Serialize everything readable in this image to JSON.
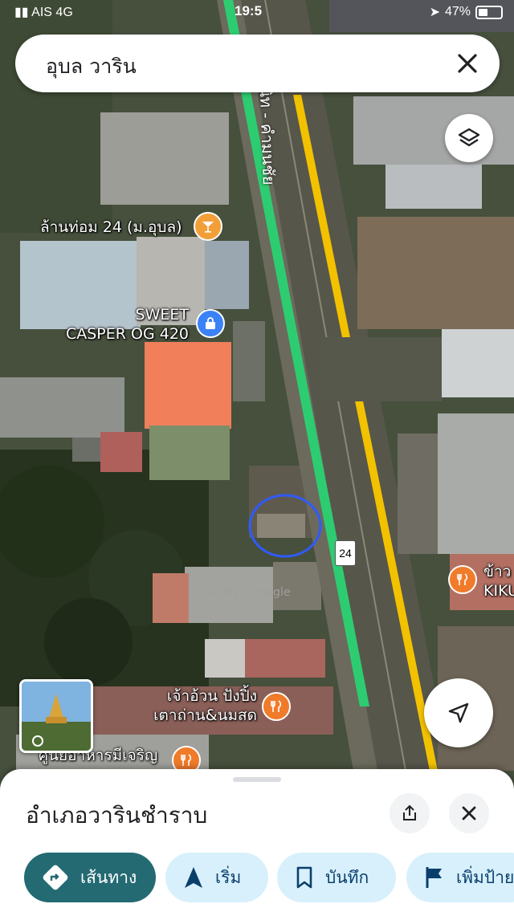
{
  "status_bar": {
    "carrier": "AIS",
    "network": "4G",
    "time": "19:5",
    "battery": "47%"
  },
  "search": {
    "query": "อุบล วาริน"
  },
  "road": {
    "name": "แจ้งสนิท - คำมนชัย",
    "shield": "24"
  },
  "pois": [
    {
      "label_lines": [
        "ล้านท่อม 24 (ม.อุบล)"
      ],
      "type": "bar",
      "color": "#f29f39"
    },
    {
      "label_lines": [
        "SWEET",
        "CASPER OG 420"
      ],
      "type": "shopping",
      "color": "#3b82f6"
    },
    {
      "label_lines": [
        "ข้าว",
        "KIKU"
      ],
      "type": "restaurant",
      "color": "#f07b2a"
    },
    {
      "label_lines": [
        "เจ้าอ้วน ปังปิ้ง",
        "เตาถ่าน&นมสด"
      ],
      "type": "restaurant",
      "color": "#f07b2a"
    },
    {
      "label_lines": [
        "ศูนย์อาหารมีเจริญ"
      ],
      "type": "restaurant",
      "color": "#f07b2a"
    }
  ],
  "watermark": "©2025 Google",
  "sheet": {
    "title": "อำเภอวารินชำราบ",
    "actions": [
      {
        "label": "เส้นทาง",
        "icon": "directions-icon"
      },
      {
        "label": "เริ่ม",
        "icon": "navigation-arrow-icon"
      },
      {
        "label": "บันทึก",
        "icon": "bookmark-icon"
      },
      {
        "label": "เพิ่มป้าย",
        "icon": "flag-icon"
      }
    ]
  },
  "colors": {
    "accent": "#236a73",
    "chip_bg": "#d7f0fc",
    "highlight_circle": "#2f5bff"
  }
}
